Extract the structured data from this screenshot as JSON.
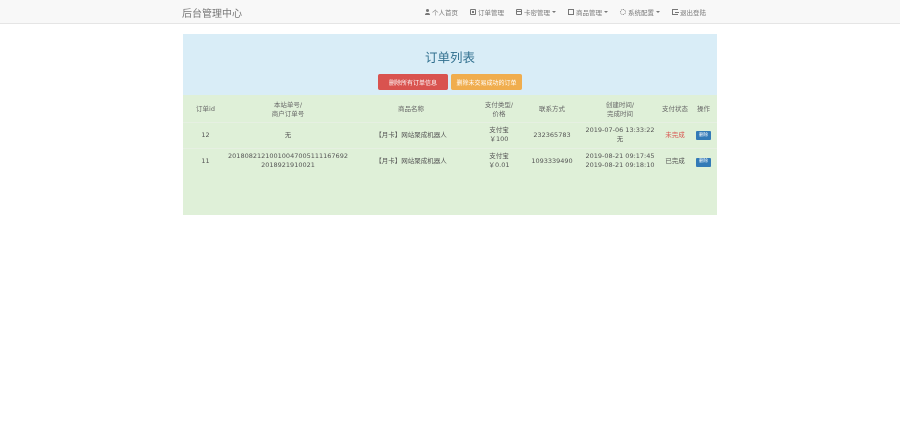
{
  "navbar": {
    "brand": "后台管理中心",
    "items": [
      {
        "label": "个人首页",
        "icon": "user-icon",
        "dropdown": false
      },
      {
        "label": "订单管理",
        "icon": "list-icon",
        "dropdown": false
      },
      {
        "label": "卡密管理",
        "icon": "card-icon",
        "dropdown": true
      },
      {
        "label": "商品管理",
        "icon": "document-icon",
        "dropdown": true
      },
      {
        "label": "系统配置",
        "icon": "gear-icon",
        "dropdown": true
      },
      {
        "label": "退出登陆",
        "icon": "exit-icon",
        "dropdown": false
      }
    ]
  },
  "panel": {
    "title": "订单列表",
    "delete_all_label": "删除所有订单信息",
    "delete_unpaid_label": "删除未交易成功的订单"
  },
  "table": {
    "headers": {
      "id": "订单id",
      "no_line1": "本站单号/",
      "no_line2": "商户订单号",
      "name": "商品名称",
      "type_line1": "支付类型/",
      "type_line2": "价格",
      "phone": "联系方式",
      "time_line1": "创建时间/",
      "time_line2": "完成时间",
      "status": "支付状态",
      "op": "操作"
    },
    "rows": [
      {
        "id": "12",
        "order_no": "无",
        "merchant_no": "",
        "name": "【月卡】网站聚成机器人",
        "pay_type": "支付宝",
        "price": "￥100",
        "phone": "232365783",
        "created_line1": "2019-07-06 13:33:22",
        "created_line2": "无",
        "status": "未完成",
        "status_color": "#d9534f",
        "op_label": "删除"
      },
      {
        "id": "11",
        "order_no": "20180821210010047005111167692",
        "merchant_no": "2018921910021",
        "name": "【月卡】网站聚成机器人",
        "pay_type": "支付宝",
        "price": "￥0.01",
        "phone": "1093339490",
        "created_line1": "2019-08-21 09:17:45",
        "created_line2": "2019-08-21 09:18:10",
        "status": "已完成",
        "status_color": "#555555",
        "op_label": "删除"
      }
    ]
  },
  "colors": {
    "panel_head_bg": "#d9edf7",
    "panel_body_bg": "#dff0d8",
    "danger": "#d9534f",
    "warning": "#f0ad4e",
    "primary": "#337ab7"
  }
}
